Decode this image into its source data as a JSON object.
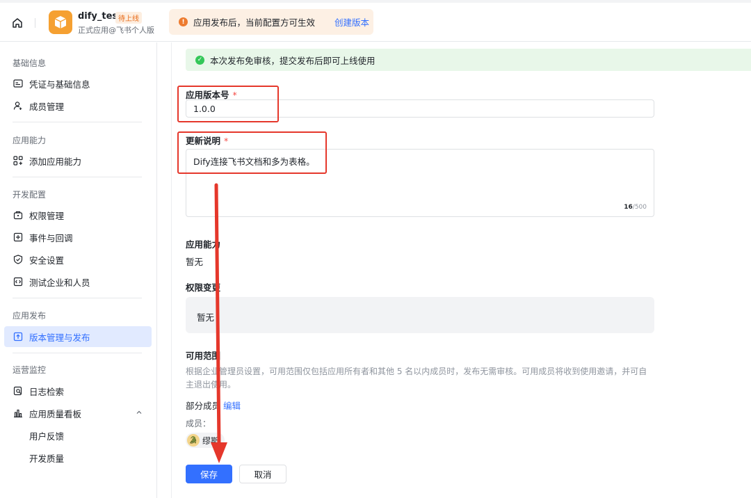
{
  "header": {
    "app_name": "dify_test",
    "app_status": "待上线",
    "app_subtitle": "正式应用@飞书个人版",
    "notice_text": "应用发布后，当前配置方可生效",
    "notice_link": "创建版本"
  },
  "sidebar": {
    "sections": [
      {
        "title": "基础信息",
        "items": [
          "凭证与基础信息",
          "成员管理"
        ]
      },
      {
        "title": "应用能力",
        "items": [
          "添加应用能力"
        ]
      },
      {
        "title": "开发配置",
        "items": [
          "权限管理",
          "事件与回调",
          "安全设置",
          "测试企业和人员"
        ]
      },
      {
        "title": "应用发布",
        "items": [
          "版本管理与发布"
        ]
      },
      {
        "title": "运营监控",
        "items": [
          "日志检索",
          "应用质量看板",
          "用户反馈",
          "开发质量"
        ]
      }
    ]
  },
  "main": {
    "success_text": "本次发布免审核，提交发布后即可上线使用",
    "version_label": "应用版本号",
    "version_value": "1.0.0",
    "required_mark": "*",
    "desc_label": "更新说明",
    "desc_value": "Dify连接飞书文档和多为表格。",
    "counter_current": "16",
    "counter_max": "/500",
    "capability_label": "应用能力",
    "capability_value": "暂无",
    "permission_label": "权限变更",
    "permission_value": "暂无",
    "scope_label": "可用范围",
    "scope_hint": "根据企业管理员设置，可用范围仅包括应用所有者和其他 5 名以内成员时，发布无需审核。可用成员将收到使用邀请，并可自主退出使用。",
    "scope_partial": "部分成员",
    "scope_edit": "编辑",
    "members_label": "成员：",
    "member_name": "缪斯",
    "save_label": "保存",
    "cancel_label": "取消"
  },
  "colors": {
    "accent": "#3370ff",
    "annotation": "#e5372b",
    "success_bg": "#e8f7e9",
    "warning": "#ed7b2f"
  }
}
